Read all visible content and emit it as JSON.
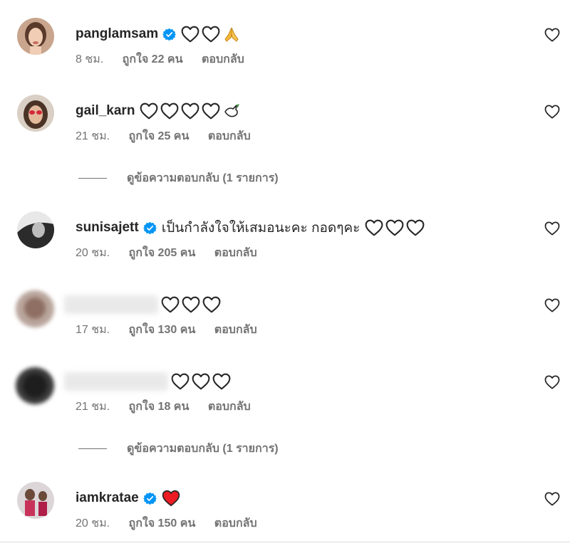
{
  "comments": [
    {
      "username": "panglamsam",
      "verified": true,
      "text": "",
      "time": "8 ชม.",
      "likes": "ถูกใจ 22 คน",
      "reply": "ตอบกลับ"
    },
    {
      "username": "gail_karn",
      "verified": false,
      "text": "",
      "time": "21 ชม.",
      "likes": "ถูกใจ 25 คน",
      "reply": "ตอบกลับ"
    },
    {
      "username": "sunisajett",
      "verified": true,
      "text": "เป็นกำลังใจให้เสมอนะคะ กอดๆคะ",
      "time": "20 ชม.",
      "likes": "ถูกใจ 205 คน",
      "reply": "ตอบกลับ"
    },
    {
      "username": "",
      "verified": false,
      "text": "",
      "time": "17 ชม.",
      "likes": "ถูกใจ 130 คน",
      "reply": "ตอบกลับ"
    },
    {
      "username": "",
      "verified": false,
      "text": "",
      "time": "21 ชม.",
      "likes": "ถูกใจ 18 คน",
      "reply": "ตอบกลับ"
    },
    {
      "username": "iamkratae",
      "verified": true,
      "text": "",
      "time": "20 ชม.",
      "likes": "ถูกใจ 150 คน",
      "reply": "ตอบกลับ"
    }
  ],
  "view_replies": [
    {
      "label": "ดูข้อความตอบกลับ (1 รายการ)"
    },
    {
      "label": "ดูข้อความตอบกลับ (1 รายการ)"
    }
  ],
  "icons": {
    "verified": "verified-badge-icon",
    "like": "heart-outline-icon",
    "red_heart": "red-heart-emoji",
    "pray": "folded-hands-emoji",
    "dove": "dove-emoji"
  },
  "colors": {
    "verified_blue": "#0095f6",
    "secondary_text": "#737373",
    "primary_text": "#262626",
    "red_heart": "#ed1c24"
  }
}
